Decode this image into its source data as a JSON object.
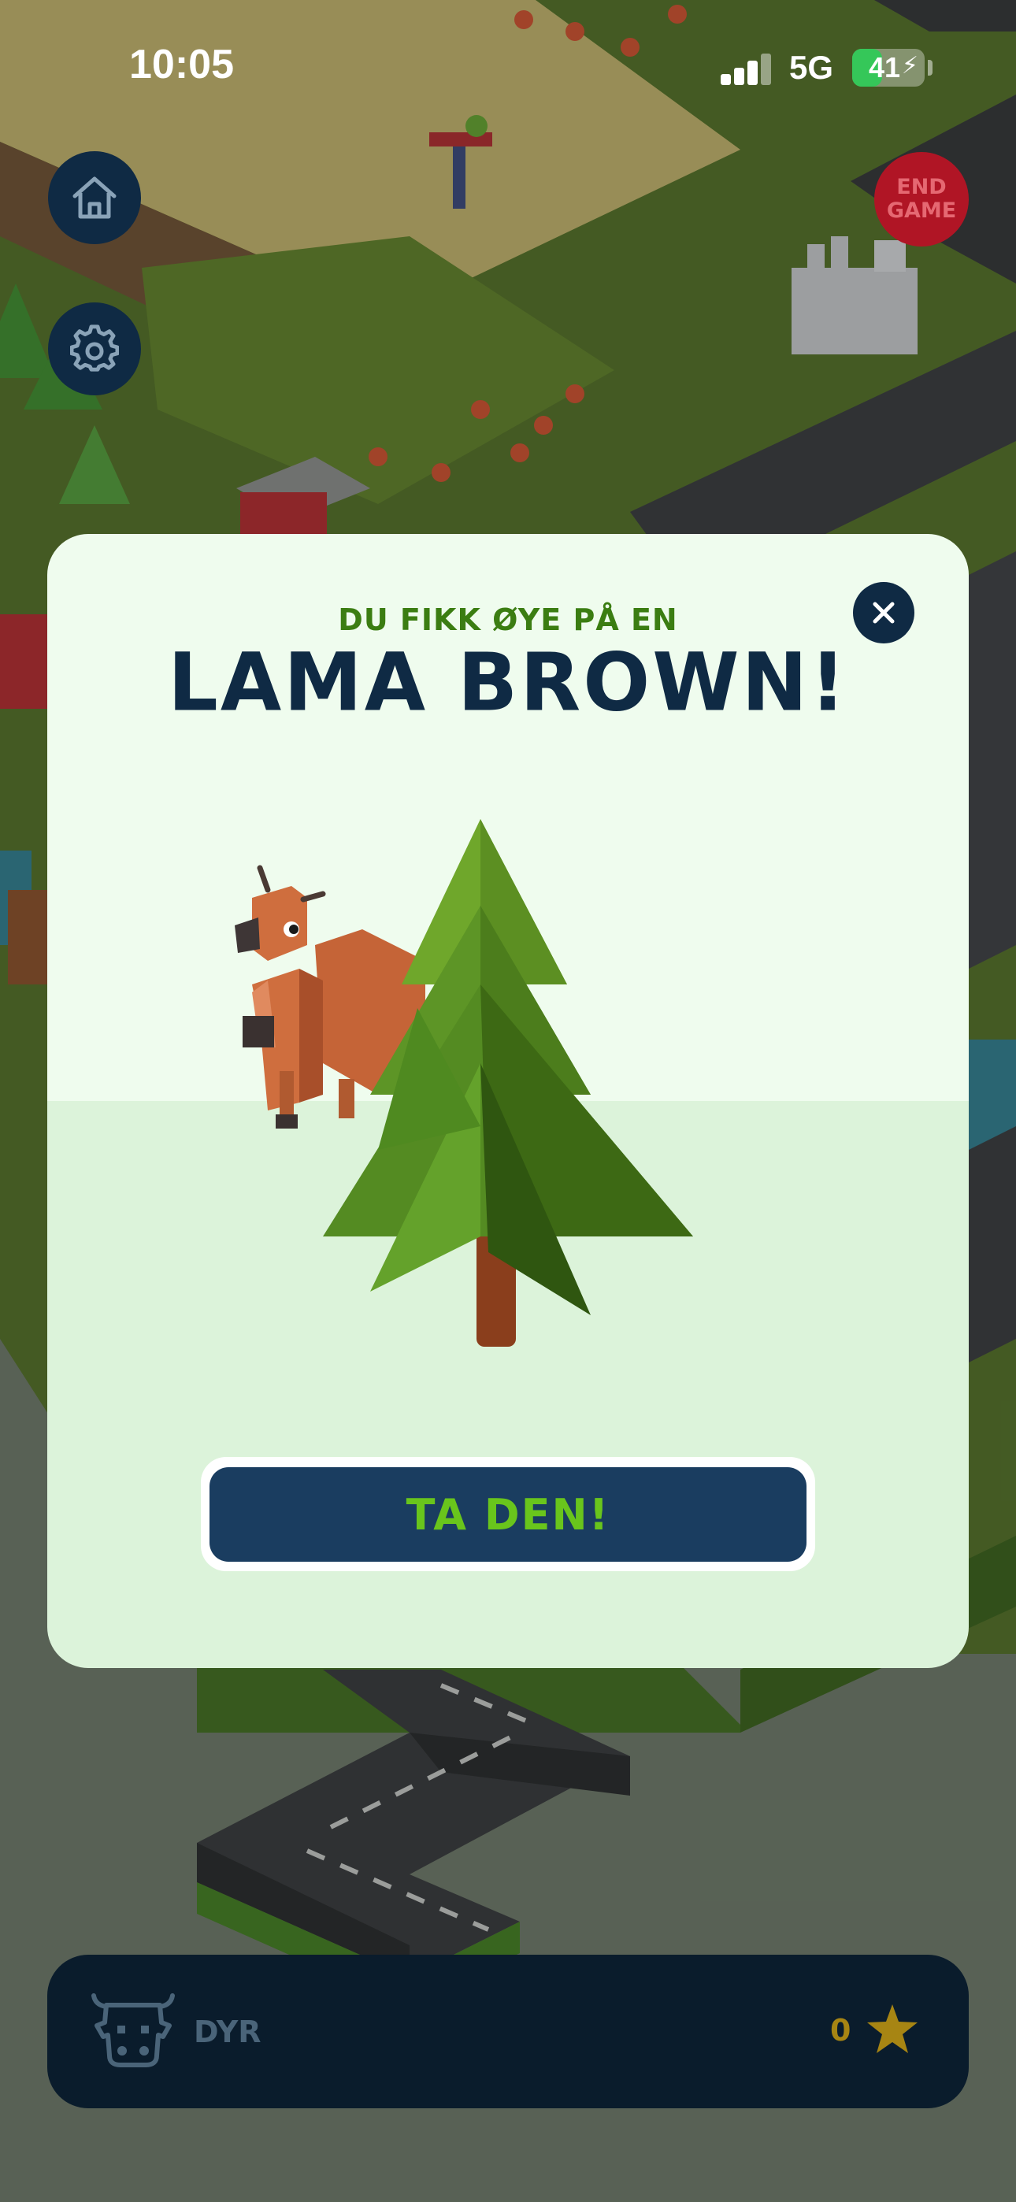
{
  "status_bar": {
    "time": "10:05",
    "network": "5G",
    "battery_percent": "41",
    "battery_level": 0.41,
    "battery_color": "#35c759"
  },
  "hud": {
    "home_icon": "home-icon",
    "settings_icon": "gear-icon",
    "end_game_line1": "END",
    "end_game_line2": "GAME"
  },
  "modal": {
    "subtitle": "DU FIKK ØYE PÅ EN",
    "title": "LAMA BROWN!",
    "close_icon": "close-icon",
    "cta_label": "TA DEN!",
    "illustration": "llama-behind-tree"
  },
  "bottom_bar": {
    "icon": "cow-head-icon",
    "label": "DYR",
    "count": "0",
    "star_icon": "star-icon"
  },
  "colors": {
    "navy": "#0f2a44",
    "green_text": "#3b7d12",
    "cta_text": "#69c51c",
    "end_game": "#b01525",
    "star": "#a78513"
  }
}
